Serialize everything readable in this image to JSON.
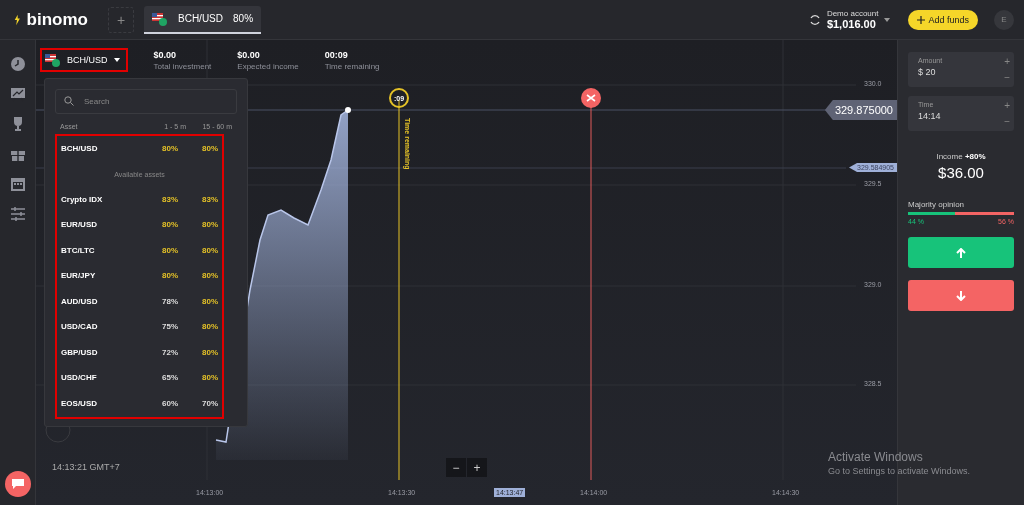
{
  "header": {
    "logo": "binomo",
    "add_tab": "+",
    "tabs": [
      {
        "label": "BCH/USD",
        "payout": "80%",
        "selected": true
      }
    ],
    "account": {
      "label": "Demo account",
      "balance": "$1,016.00"
    },
    "add_funds": "Add funds",
    "avatar": "E"
  },
  "chart_header": {
    "asset": "BCH/USD",
    "stats": [
      {
        "value": "$0.00",
        "label": "Total investment"
      },
      {
        "value": "$0.00",
        "label": "Expected income"
      },
      {
        "value": "00:09",
        "label": "Time remaining"
      }
    ]
  },
  "asset_menu": {
    "search": {
      "placeholder": "Search"
    },
    "columns": [
      "Asset",
      "1 - 5 m",
      "15 - 60 m"
    ],
    "current": {
      "name": "BCH/USD",
      "rates": [
        {
          "value": "80%",
          "highlighted": true
        },
        {
          "value": "80%",
          "highlighted": true
        }
      ]
    },
    "section": "Available assets",
    "assets": [
      {
        "name": "Crypto IDX",
        "rates": [
          {
            "value": "83%",
            "highlighted": true
          },
          {
            "value": "83%",
            "highlighted": true
          }
        ]
      },
      {
        "name": "EUR/USD",
        "rates": [
          {
            "value": "80%",
            "highlighted": true
          },
          {
            "value": "80%",
            "highlighted": true
          }
        ]
      },
      {
        "name": "BTC/LTC",
        "rates": [
          {
            "value": "80%",
            "highlighted": true
          },
          {
            "value": "80%",
            "highlighted": true
          }
        ]
      },
      {
        "name": "EUR/JPY",
        "rates": [
          {
            "value": "80%",
            "highlighted": true
          },
          {
            "value": "80%",
            "highlighted": true
          }
        ]
      },
      {
        "name": "AUD/USD",
        "rates": [
          {
            "value": "78%",
            "highlighted": false
          },
          {
            "value": "80%",
            "highlighted": true
          }
        ]
      },
      {
        "name": "USD/CAD",
        "rates": [
          {
            "value": "75%",
            "highlighted": false
          },
          {
            "value": "80%",
            "highlighted": true
          }
        ]
      },
      {
        "name": "GBP/USD",
        "rates": [
          {
            "value": "72%",
            "highlighted": false
          },
          {
            "value": "80%",
            "highlighted": true
          }
        ]
      },
      {
        "name": "USD/CHF",
        "rates": [
          {
            "value": "65%",
            "highlighted": false
          },
          {
            "value": "80%",
            "highlighted": true
          }
        ]
      },
      {
        "name": "EOS/USD",
        "rates": [
          {
            "value": "60%",
            "highlighted": false
          },
          {
            "value": "70%",
            "highlighted": false
          }
        ]
      }
    ]
  },
  "chart": {
    "price_labels": [
      "330.0",
      "329.5",
      "329.0",
      "328.5"
    ],
    "current_price": "329.875000",
    "strike_price": "329.584905",
    "timer": ":09",
    "timer_caption": "Time remaining",
    "time_labels": [
      "14:13:00",
      "14:13:30",
      "14:13:47",
      "14:14:00",
      "14:14:30"
    ],
    "clock": "14:13:21 GMT+7",
    "zoom_out": "−",
    "zoom_in": "+"
  },
  "trade_panel": {
    "fields": [
      {
        "label": "Amount",
        "value": "$ 20",
        "increase": "+",
        "decrease": "−"
      },
      {
        "label": "Time",
        "value": "14:14",
        "increase": "+",
        "decrease": "−"
      }
    ],
    "income_label": "Income",
    "income_rate": "+80%",
    "income_value": "$36.00",
    "majority": {
      "label": "Majority opinion",
      "level": 0.44,
      "up": "44 %",
      "down": "56 %"
    }
  },
  "os_notice": {
    "title": "Activate Windows",
    "text": "Go to Settings to activate Windows."
  }
}
